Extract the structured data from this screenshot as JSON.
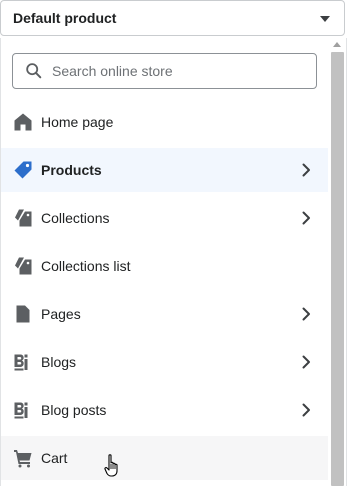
{
  "template_select": {
    "label": "Default product"
  },
  "search": {
    "placeholder": "Search online store"
  },
  "nav": {
    "items": [
      {
        "label": "Home page",
        "icon": "home-icon",
        "has_submenu": false
      },
      {
        "label": "Products",
        "icon": "tag-icon",
        "has_submenu": true,
        "selected": true,
        "accent": "#2c6ecb"
      },
      {
        "label": "Collections",
        "icon": "collections-icon",
        "has_submenu": true
      },
      {
        "label": "Collections list",
        "icon": "collections-icon",
        "has_submenu": false
      },
      {
        "label": "Pages",
        "icon": "page-icon",
        "has_submenu": true
      },
      {
        "label": "Blogs",
        "icon": "blog-icon",
        "has_submenu": true
      },
      {
        "label": "Blog posts",
        "icon": "blog-icon",
        "has_submenu": true
      },
      {
        "label": "Cart",
        "icon": "cart-icon",
        "has_submenu": false,
        "hovered": true
      }
    ]
  },
  "colors": {
    "selected_bg": "#f2f7fe",
    "hover_bg": "#f6f6f7",
    "icon": "#5c5f62",
    "selected_icon": "#2c6ecb"
  }
}
